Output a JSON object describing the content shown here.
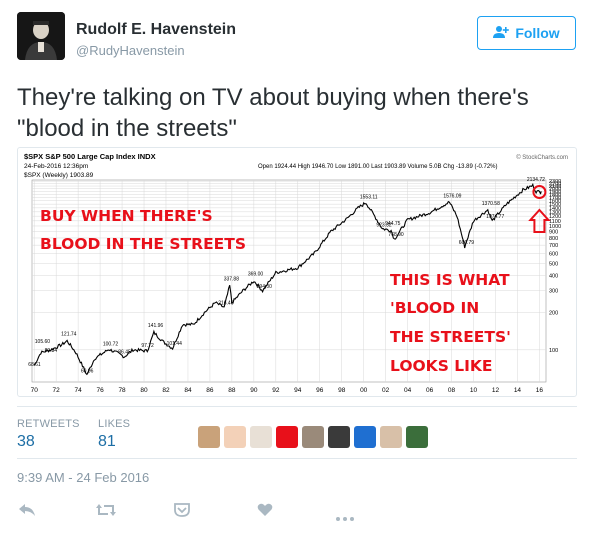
{
  "user": {
    "name": "Rudolf E. Havenstein",
    "handle": "@RudyHavenstein"
  },
  "follow_label": "Follow",
  "tweet_text": "They're talking on TV about buying when there's \"blood in the streets\"",
  "chart_image": {
    "symbol_line": "$SPX S&P 500 Large Cap Index  INDX",
    "date_line": "24-Feb-2016 12:36pm",
    "legend_line": "$SPX (Weekly) 1903.89",
    "ohlc_line": "Open 1924.44  High 1946.70  Low 1891.00  Last 1903.89  Volume 5.0B  Chg -13.89 (-0.72%)",
    "watermark": "© StockCharts.com",
    "overlay_left_1": "BUY WHEN THERE'S",
    "overlay_left_2": "BLOOD IN THE STREETS",
    "overlay_right_1": "THIS IS WHAT",
    "overlay_right_2": "'BLOOD IN",
    "overlay_right_3": "THE STREETS'",
    "overlay_right_4": "LOOKS LIKE",
    "colors": {
      "overlay": "#e8101a",
      "line": "#000000",
      "grid": "#d8d8d8"
    }
  },
  "chart_data": {
    "type": "line",
    "title": "$SPX S&P 500 Large Cap Index",
    "x_ticks": [
      "70",
      "72",
      "74",
      "76",
      "78",
      "80",
      "82",
      "84",
      "86",
      "88",
      "90",
      "92",
      "94",
      "96",
      "98",
      "00",
      "02",
      "04",
      "06",
      "08",
      "10",
      "12",
      "14",
      "16"
    ],
    "y_ticks": [
      "2300",
      "2200",
      "2100",
      "2000",
      "1900",
      "1800",
      "1700",
      "1600",
      "1500",
      "1400",
      "1300",
      "1200",
      "1100",
      "1000",
      "900",
      "800",
      "700",
      "600",
      "500",
      "400",
      "300",
      "200",
      "100"
    ],
    "log_scale": true,
    "annotations": [
      {
        "label": "68.61",
        "x": 1970.0,
        "y": 68.61
      },
      {
        "label": "105.60",
        "x": 1970.6,
        "y": 105.6
      },
      {
        "label": "89.34",
        "x": 1971.5,
        "y": 89.34
      },
      {
        "label": "121.74",
        "x": 1973.0,
        "y": 121.74
      },
      {
        "label": "60.96",
        "x": 1974.8,
        "y": 60.96
      },
      {
        "label": "100.72",
        "x": 1976.8,
        "y": 100.72
      },
      {
        "label": "86.45",
        "x": 1978.2,
        "y": 86.45
      },
      {
        "label": "97.72",
        "x": 1980.3,
        "y": 97.72
      },
      {
        "label": "141.96",
        "x": 1980.9,
        "y": 141.96
      },
      {
        "label": "101.44",
        "x": 1982.6,
        "y": 101.44
      },
      {
        "label": "216.46",
        "x": 1987.3,
        "y": 216.46
      },
      {
        "label": "337.88",
        "x": 1987.8,
        "y": 337.88
      },
      {
        "label": "369.00",
        "x": 1990.0,
        "y": 369.0
      },
      {
        "label": "294.00",
        "x": 1990.8,
        "y": 294.0
      },
      {
        "label": "1553.11",
        "x": 2000.2,
        "y": 1553.11
      },
      {
        "label": "923.32",
        "x": 2001.7,
        "y": 923.32
      },
      {
        "label": "944.75",
        "x": 2002.5,
        "y": 944.75
      },
      {
        "label": "768.90",
        "x": 2002.8,
        "y": 768.9
      },
      {
        "label": "1576.09",
        "x": 2007.8,
        "y": 1576.09
      },
      {
        "label": "666.79",
        "x": 2009.2,
        "y": 666.79
      },
      {
        "label": "1370.58",
        "x": 2011.3,
        "y": 1370.58
      },
      {
        "label": "1074.77",
        "x": 2011.7,
        "y": 1074.77
      },
      {
        "label": "2134.72",
        "x": 2015.4,
        "y": 2134.72
      }
    ],
    "series": [
      {
        "values": [
          {
            "x": 1970.0,
            "y": 75
          },
          {
            "x": 1970.6,
            "y": 95
          },
          {
            "x": 1971.5,
            "y": 100
          },
          {
            "x": 1972.5,
            "y": 110
          },
          {
            "x": 1973.0,
            "y": 118
          },
          {
            "x": 1973.8,
            "y": 95
          },
          {
            "x": 1974.8,
            "y": 63
          },
          {
            "x": 1975.5,
            "y": 85
          },
          {
            "x": 1976.8,
            "y": 101
          },
          {
            "x": 1977.5,
            "y": 95
          },
          {
            "x": 1978.2,
            "y": 88
          },
          {
            "x": 1979.0,
            "y": 100
          },
          {
            "x": 1980.3,
            "y": 98
          },
          {
            "x": 1980.9,
            "y": 138
          },
          {
            "x": 1981.8,
            "y": 115
          },
          {
            "x": 1982.6,
            "y": 103
          },
          {
            "x": 1983.5,
            "y": 160
          },
          {
            "x": 1984.5,
            "y": 160
          },
          {
            "x": 1985.5,
            "y": 200
          },
          {
            "x": 1986.5,
            "y": 240
          },
          {
            "x": 1987.3,
            "y": 220
          },
          {
            "x": 1987.8,
            "y": 330
          },
          {
            "x": 1988.0,
            "y": 240
          },
          {
            "x": 1989.0,
            "y": 300
          },
          {
            "x": 1990.0,
            "y": 360
          },
          {
            "x": 1990.8,
            "y": 300
          },
          {
            "x": 1992.0,
            "y": 420
          },
          {
            "x": 1994.0,
            "y": 460
          },
          {
            "x": 1995.5,
            "y": 600
          },
          {
            "x": 1997.0,
            "y": 900
          },
          {
            "x": 1998.5,
            "y": 1150
          },
          {
            "x": 1999.5,
            "y": 1400
          },
          {
            "x": 2000.2,
            "y": 1540
          },
          {
            "x": 2001.0,
            "y": 1200
          },
          {
            "x": 2001.7,
            "y": 950
          },
          {
            "x": 2002.5,
            "y": 920
          },
          {
            "x": 2002.8,
            "y": 780
          },
          {
            "x": 2004.0,
            "y": 1120
          },
          {
            "x": 2006.0,
            "y": 1280
          },
          {
            "x": 2007.8,
            "y": 1560
          },
          {
            "x": 2008.5,
            "y": 1200
          },
          {
            "x": 2009.2,
            "y": 680
          },
          {
            "x": 2010.0,
            "y": 1100
          },
          {
            "x": 2011.3,
            "y": 1350
          },
          {
            "x": 2011.7,
            "y": 1100
          },
          {
            "x": 2013.0,
            "y": 1500
          },
          {
            "x": 2014.5,
            "y": 1950
          },
          {
            "x": 2015.4,
            "y": 2120
          },
          {
            "x": 2015.7,
            "y": 1900
          },
          {
            "x": 2016.1,
            "y": 1880
          },
          {
            "x": 2016.15,
            "y": 1904
          }
        ]
      }
    ]
  },
  "stats": {
    "retweets_label": "RETWEETS",
    "retweets_value": "38",
    "likes_label": "LIKES",
    "likes_value": "81"
  },
  "likers": [
    "#c9a27a",
    "#f3d1b8",
    "#e8e0d6",
    "#e8101a",
    "#9a8a7a",
    "#3a3a3a",
    "#1f6fd1",
    "#d8c0a8",
    "#3b6e3b"
  ],
  "timestamp": "9:39 AM - 24 Feb 2016",
  "actions": [
    "reply-icon",
    "retweet-icon",
    "share-icon",
    "like-icon",
    "more-icon"
  ]
}
